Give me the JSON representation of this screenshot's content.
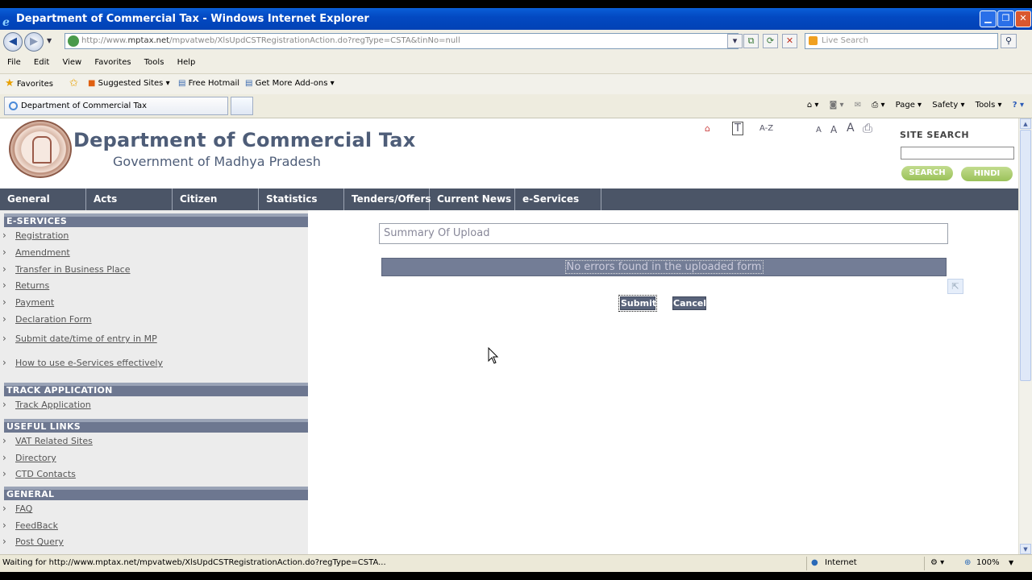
{
  "window": {
    "title": "Department of Commercial Tax - Windows Internet Explorer"
  },
  "browser": {
    "address_prefix": "http://www.",
    "address_domain": "mptax.net",
    "address_path": "/mpvatweb/XlsUpdCSTRegistrationAction.do?regType=CSTA&tinNo=null",
    "search_placeholder": "Live Search",
    "menu": [
      "File",
      "Edit",
      "View",
      "Favorites",
      "Tools",
      "Help"
    ],
    "favorites_label": "Favorites",
    "fav_items": [
      "Suggested Sites ▾",
      "Free Hotmail",
      "Get More Add-ons ▾"
    ],
    "tab_title": "Department of Commercial Tax",
    "tools": [
      "Page ▾",
      "Safety ▾",
      "Tools ▾"
    ]
  },
  "header": {
    "title": "Department of Commercial Tax",
    "subtitle": "Government of Madhya Pradesh",
    "az_label": "A-Z",
    "font_sizes": [
      "A",
      "A",
      "A"
    ],
    "site_search_label": "SITE SEARCH",
    "search_button": "SEARCH",
    "hindi_button": "HINDI"
  },
  "nav": [
    "General",
    "Acts",
    "Citizen Charter",
    "Statistics",
    "Tenders/Offers",
    "Current News",
    "e-Services"
  ],
  "sidebar": {
    "sections": [
      {
        "title": "E-SERVICES",
        "items": [
          "Registration",
          "Amendment",
          "Transfer in Business Place",
          "Returns",
          "Payment",
          "Declaration Form",
          "Submit date/time of entry in MP",
          "How to use e-Services effectively"
        ]
      },
      {
        "title": "TRACK APPLICATION",
        "items": [
          "Track Application"
        ]
      },
      {
        "title": "USEFUL LINKS",
        "items": [
          "VAT Related Sites",
          "Directory",
          "CTD Contacts"
        ]
      },
      {
        "title": "GENERAL",
        "items": [
          "FAQ",
          "FeedBack",
          "Post Query"
        ]
      }
    ]
  },
  "content": {
    "summary_title": "Summary Of Upload",
    "message": "No errors found in the uploaded form",
    "submit_label": "Submit",
    "cancel_label": "Cancel"
  },
  "status": {
    "text": "Waiting for http://www.mptax.net/mpvatweb/XlsUpdCSTRegistrationAction.do?regType=CSTA...",
    "zone": "Internet",
    "zoom": "100%"
  },
  "colors": {
    "nav_bg": "#4b5567",
    "title_text": "#4e5d78",
    "section_head": "#6d7790"
  }
}
